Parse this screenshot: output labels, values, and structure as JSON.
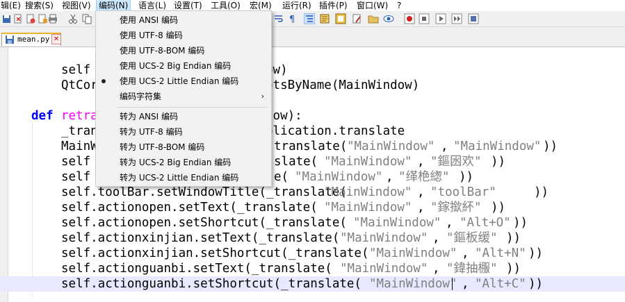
{
  "menubar": {
    "items": [
      "辑(E)",
      "搜索(S)",
      "视图(V)",
      "编码(N)",
      "语言(L)",
      "设置(T)",
      "工具(O)",
      "宏(M)",
      "运行(R)",
      "插件(P)",
      "窗口(W)",
      "?"
    ],
    "active_index": 3
  },
  "tab": {
    "filename": "mean.py",
    "close_glyph": "✕"
  },
  "encoding_menu": {
    "use_items": [
      "使用 ANSI 编码",
      "使用 UTF-8 编码",
      "使用 UTF-8-BOM 编码",
      "使用 UCS-2 Big Endian 编码",
      "使用 UCS-2 Little Endian 编码"
    ],
    "selected_index": 4,
    "charset_label": "编码字符集",
    "submenu_arrow": "›",
    "convert_items": [
      "转为 ANSI 编码",
      "转为 UTF-8 编码",
      "转为 UTF-8-BOM 编码",
      "转为 UCS-2 Big Endian 编码",
      "转为 UCS-2 Little Endian 编码"
    ]
  },
  "code": {
    "l1": {
      "a": "self",
      "b": "ow)"
    },
    "l2": {
      "a": "QtCor",
      "b": "otsByName(MainWindow)"
    },
    "l3": {
      "kw": "def",
      "fn": "retra",
      "b": "dow):"
    },
    "l4": {
      "a": "_tran",
      "b": "plication.translate"
    },
    "l5": {
      "a": "MainW",
      "b": "translate(",
      "s1": "\"MainWindow\"",
      "c": ", ",
      "s2": "\"MainWindow\"",
      "d": "))"
    },
    "l6": {
      "a": "self",
      "b": "slate(",
      "s1": "\"MainWindow\"",
      "c": ", ",
      "s2": "\"鏂囦欢\"",
      "d": "))"
    },
    "l7": {
      "a": "self",
      "b": "e(",
      "s1": "\"MainWindow\"",
      "c": ", ",
      "s2": "\"缂栬緫\"",
      "d": "))"
    },
    "l8": {
      "a": "self.toolBar.setWindowTitle(_translate(",
      "s1": "\"MainWindow\"",
      "c": ", ",
      "s2": "\"toolBar\"",
      "d": "))"
    },
    "l9": {
      "a": "self.actionopen.setText(_translate(",
      "s1": "\"MainWindow\"",
      "c": ", ",
      "s2": "\"鎵撳紑\"",
      "d": "))"
    },
    "l10": {
      "a": "self.actionopen.setShortcut(_translate(",
      "s1": "\"MainWindow\"",
      "c": ", ",
      "s2": "\"Alt+O\"",
      "d": "))"
    },
    "l11": {
      "a": "self.actionxinjian.setText(_translate(",
      "s1": "\"MainWindow\"",
      "c": ", ",
      "s2": "\"鏂板缓\"",
      "d": "))"
    },
    "l12": {
      "a": "self.actionxinjian.setShortcut(_translate(",
      "s1": "\"MainWindow\"",
      "c": ", ",
      "s2": "\"Alt+N\"",
      "d": "))"
    },
    "l13": {
      "a": "self.actionguanbi.setText(_translate(",
      "s1": "\"MainWindow\"",
      "c": ", ",
      "s2": "\"鍏抽棴\"",
      "d": "))"
    },
    "l14": {
      "a": "self.actionguanbi.setShortcut(_translate(",
      "s1": "\"MainWindow\"",
      "c": ", ",
      "s2": "\"Alt+C\"",
      "d": "))"
    }
  },
  "colors": {
    "keyword": "#0000ff",
    "function": "#ff00ff",
    "string": "#808080",
    "current_line": "#e8e8ff",
    "menu_highlight": "#cce8ff"
  }
}
